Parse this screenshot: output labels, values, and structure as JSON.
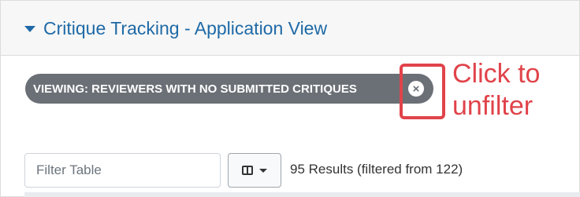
{
  "header": {
    "title": "Critique Tracking - Application View"
  },
  "filter": {
    "active_label": "VIEWING: REVIEWERS WITH NO SUBMITTED CRITIQUES",
    "clear_icon": "times-circle-icon"
  },
  "annotation": {
    "line1": "Click to",
    "line2": "unfilter",
    "color": "#e0444a"
  },
  "toolbar": {
    "filter_placeholder": "Filter Table",
    "filter_value": "",
    "columns_icon": "columns-icon",
    "results_text": "95 Results (filtered from 122)"
  },
  "colors": {
    "accent": "#1f6aa6",
    "pill": "#6b7076"
  }
}
